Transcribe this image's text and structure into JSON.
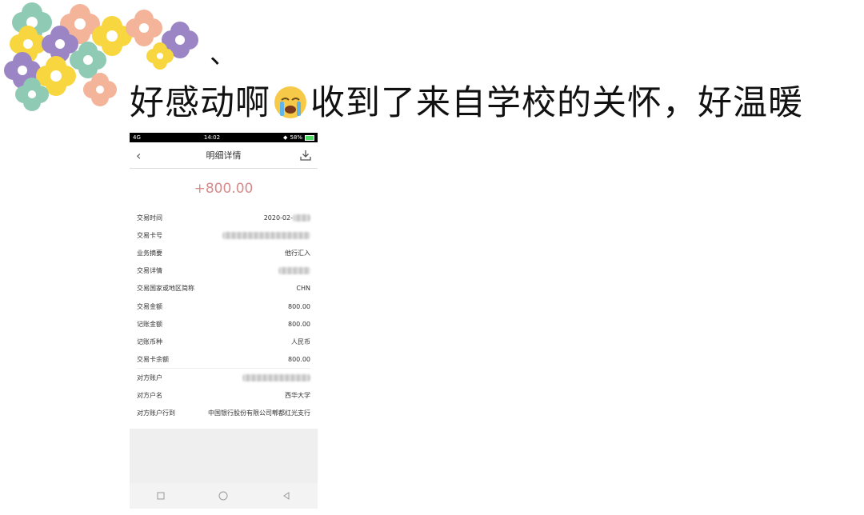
{
  "post": {
    "heading_mark": "、",
    "caption_before": "好感动啊",
    "caption_emoji": "crying-face-icon",
    "caption_after": "收到了来自学校的关怀，好温暖"
  },
  "phone": {
    "status": {
      "signal": "4G",
      "time": "14:02",
      "battery": "58%"
    },
    "header": {
      "title": "明细详情"
    },
    "amount": "+800.00",
    "rows": [
      {
        "label": "交易时间",
        "value": "2020-02-"
      },
      {
        "label": "交易卡号",
        "value": ""
      },
      {
        "label": "业务摘要",
        "value": "他行汇入"
      },
      {
        "label": "交易详情",
        "value": ""
      },
      {
        "label": "交易国家或地区简称",
        "value": "CHN"
      },
      {
        "label": "交易金额",
        "value": "800.00"
      },
      {
        "label": "记账金额",
        "value": "800.00"
      },
      {
        "label": "记账币种",
        "value": "人民币"
      },
      {
        "label": "交易卡余额",
        "value": "800.00"
      },
      {
        "label": "对方账户",
        "value": ""
      },
      {
        "label": "对方户名",
        "value": "西华大学"
      },
      {
        "label": "对方账户行到",
        "value": "中国银行股份有限公司郫都红光支行"
      }
    ]
  },
  "colors": {
    "amount": "#d78a8a",
    "flower_yellow": "#f7d640",
    "flower_purple": "#9b85c4",
    "flower_teal": "#8fcab4",
    "flower_peach": "#f4b49a"
  }
}
